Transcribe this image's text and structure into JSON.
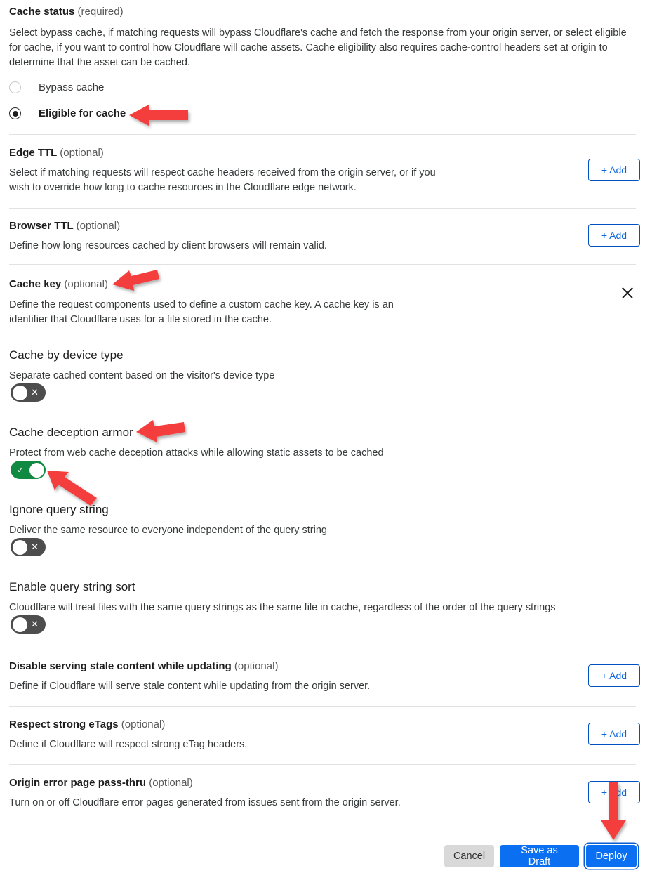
{
  "cache_status": {
    "title": "Cache status",
    "qualifier": "(required)",
    "description": "Select bypass cache, if matching requests will bypass Cloudflare's cache and fetch the response from your origin server, or select eligible for cache, if you want to control how Cloudflare will cache assets. Cache eligibility also requires cache-control headers set at origin to determine that the asset can be cached.",
    "options": [
      {
        "label": "Bypass cache",
        "selected": false
      },
      {
        "label": "Eligible for cache",
        "selected": true
      }
    ]
  },
  "edge_ttl": {
    "title": "Edge TTL",
    "qualifier": "(optional)",
    "description": "Select if matching requests will respect cache headers received from the origin server, or if you wish to override how long to cache resources in the Cloudflare edge network.",
    "add_label": "+ Add"
  },
  "browser_ttl": {
    "title": "Browser TTL",
    "qualifier": "(optional)",
    "description": "Define how long resources cached by client browsers will remain valid.",
    "add_label": "+ Add"
  },
  "cache_key": {
    "title": "Cache key",
    "qualifier": "(optional)",
    "description": "Define the request components used to define a custom cache key. A cache key is an identifier that Cloudflare uses for a file stored in the cache.",
    "close_icon": "close-icon"
  },
  "cache_by_device_type": {
    "title": "Cache by device type",
    "description": "Separate cached content based on the visitor's device type",
    "toggle_state": "off",
    "toggle_glyph": "✕"
  },
  "cache_deception_armor": {
    "title": "Cache deception armor",
    "description": "Protect from web cache deception attacks while allowing static assets to be cached",
    "toggle_state": "on",
    "toggle_glyph": "✓"
  },
  "ignore_query_string": {
    "title": "Ignore query string",
    "description": "Deliver the same resource to everyone independent of the query string",
    "toggle_state": "off",
    "toggle_glyph": "✕"
  },
  "enable_query_string_sort": {
    "title": "Enable query string sort",
    "description": "Cloudflare will treat files with the same query strings as the same file in cache, regardless of the order of the query strings",
    "toggle_state": "off",
    "toggle_glyph": "✕"
  },
  "disable_stale_content": {
    "title": "Disable serving stale content while updating",
    "qualifier": "(optional)",
    "description": "Define if Cloudflare will serve stale content while updating from the origin server.",
    "add_label": "+ Add"
  },
  "respect_strong_etags": {
    "title": "Respect strong eTags",
    "qualifier": "(optional)",
    "description": "Define if Cloudflare will respect strong eTag headers.",
    "add_label": "+ Add"
  },
  "origin_error_page": {
    "title": "Origin error page pass-thru",
    "qualifier": "(optional)",
    "description": "Turn on or off Cloudflare error pages generated from issues sent from the origin server.",
    "add_label": "+ Add"
  },
  "footer": {
    "cancel_label": "Cancel",
    "save_draft_label": "Save as Draft",
    "deploy_label": "Deploy"
  },
  "annotations": {
    "arrow_color": "#f43d3d",
    "items": [
      {
        "name": "arrow-eligible-for-cache",
        "direction": "left"
      },
      {
        "name": "arrow-cache-key",
        "direction": "left"
      },
      {
        "name": "arrow-cache-deception-armor-title",
        "direction": "left"
      },
      {
        "name": "arrow-cache-deception-armor-toggle",
        "direction": "up-left"
      },
      {
        "name": "arrow-deploy-button",
        "direction": "down"
      }
    ]
  },
  "colors": {
    "accent_blue": "#0b6ff2",
    "border_blue": "#0051c3",
    "toggle_on_green": "#108a40",
    "toggle_off_gray": "#4d4d4d",
    "arrow_red": "#f43d3d"
  }
}
